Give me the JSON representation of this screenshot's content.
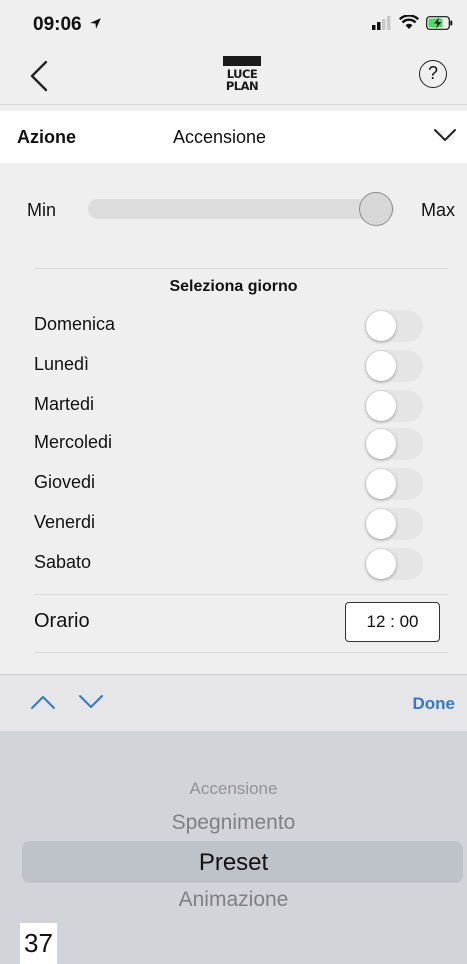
{
  "status_bar": {
    "time": "09:06"
  },
  "nav": {
    "logo_line1": "LUCE",
    "logo_line2": "PLAN",
    "help_label": "?"
  },
  "action": {
    "label": "Azione",
    "value": "Accensione"
  },
  "slider": {
    "min_label": "Min",
    "max_label": "Max",
    "level_percent": 100
  },
  "days": {
    "title": "Seleziona giorno",
    "items": [
      {
        "label": "Domenica",
        "on": false
      },
      {
        "label": "Lunedì",
        "on": false
      },
      {
        "label": "Martedi",
        "on": false
      },
      {
        "label": "Mercoledi",
        "on": false
      },
      {
        "label": "Giovedi",
        "on": false
      },
      {
        "label": "Venerdi",
        "on": false
      },
      {
        "label": "Sabato",
        "on": false
      }
    ]
  },
  "time": {
    "label": "Orario",
    "value": "12 : 00"
  },
  "toolbar": {
    "done_label": "Done"
  },
  "picker": {
    "options": [
      "Accensione",
      "Spegnimento",
      "Preset",
      "Animazione"
    ],
    "selected": "Preset"
  },
  "page_number": "37",
  "colors": {
    "accent": "#3478c7",
    "background": "#efefef",
    "picker_bg": "#d1d4d9"
  }
}
